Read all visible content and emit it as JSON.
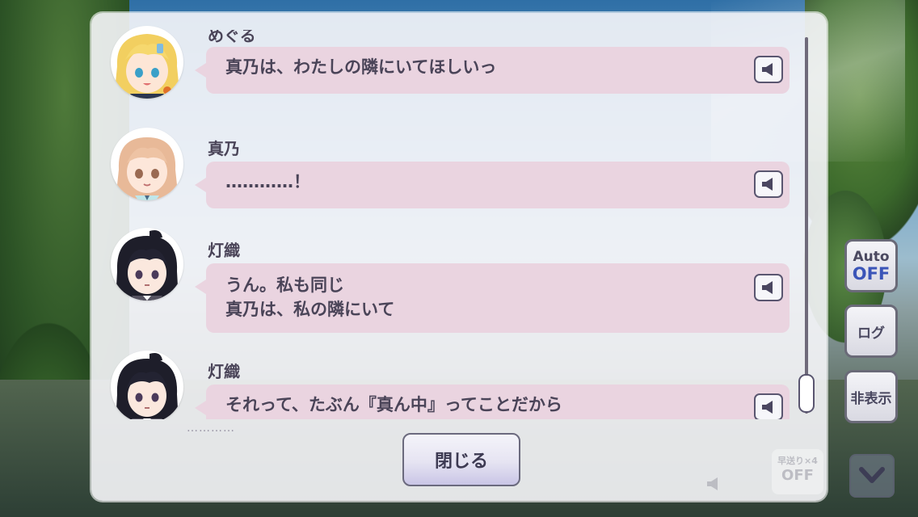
{
  "side_buttons": {
    "auto_top": "Auto",
    "auto_state": "OFF",
    "log": "ログ",
    "hide": "非表示"
  },
  "log": {
    "entries": [
      {
        "speaker": "めぐる",
        "lines": [
          "真乃は、わたしの隣にいてほしいっ"
        ],
        "avatar": "meguru-avatar"
      },
      {
        "speaker": "真乃",
        "lines": [
          "…………！"
        ],
        "avatar": "mano-avatar"
      },
      {
        "speaker": "灯織",
        "lines": [
          "うん。私も同じ",
          "真乃は、私の隣にいて"
        ],
        "avatar": "hiori-avatar"
      },
      {
        "speaker": "灯織",
        "lines": [
          "それって、たぶん『真ん中』ってことだから"
        ],
        "avatar": "hiori-avatar"
      }
    ],
    "peek_text": "…………",
    "close_label": "閉じる",
    "ghost_ff_label": "早送り×4",
    "ghost_ff_state": "OFF"
  },
  "colors": {
    "bubble": "#ead4e0",
    "text": "#4a4458",
    "auto_off": "#3b55b8"
  }
}
